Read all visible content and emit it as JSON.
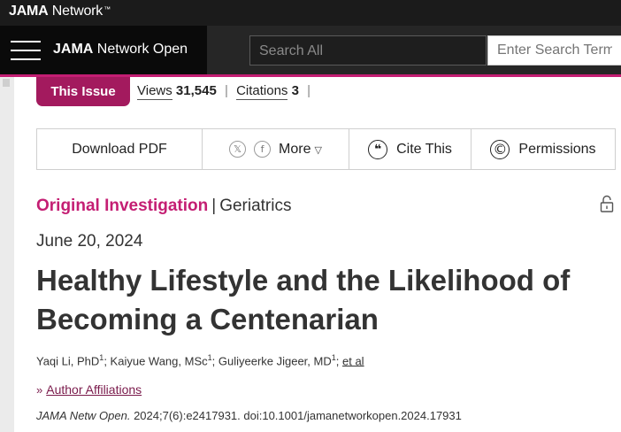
{
  "network_bar": {
    "logo_bold": "JAMA",
    "logo_rest": " Network",
    "tm": "™"
  },
  "journal_header": {
    "menu_icon": "hamburger-icon",
    "journal_bold": "JAMA",
    "journal_rest": " Network Open",
    "search_scope": "Search All",
    "search_placeholder": "Enter Search Term"
  },
  "issue_bar": {
    "this_issue_label": "This Issue",
    "views_label": "Views",
    "views_count": "31,545",
    "citations_label": "Citations",
    "citations_count": "3",
    "separator": "|"
  },
  "toolbar": {
    "download_label": "Download PDF",
    "share_icons": [
      "x-icon",
      "facebook-icon"
    ],
    "x_glyph": "𝕏",
    "fb_glyph": "f",
    "more_label": "More",
    "more_caret": "▽",
    "cite_icon_glyph": "❝",
    "cite_label": "Cite This",
    "permissions_icon_glyph": "©",
    "permissions_label": "Permissions"
  },
  "article": {
    "type": "Original Investigation",
    "type_sep": "|",
    "subject": "Geriatrics",
    "lock_icon": "unlock-icon",
    "date": "June 20, 2024",
    "title": "Healthy Lifestyle and the Likelihood of Becoming a Centenarian",
    "authors": [
      {
        "name": "Yaqi Li, PhD",
        "sup": "1"
      },
      {
        "name": "Kaiyue Wang, MSc",
        "sup": "1"
      },
      {
        "name": "Guliyeerke Jigeer, MD",
        "sup": "1"
      }
    ],
    "author_sep": "; ",
    "et_al": "et al",
    "affiliations_chevron": "»",
    "affiliations_label": "Author Affiliations",
    "citation_journal": "JAMA Netw Open.",
    "citation_rest": " 2024;7(6):e2417931. doi:10.1001/jamanetworkopen.2024.17931"
  },
  "colors": {
    "accent": "#c41e73",
    "issue_badge": "#a31a5e",
    "header_dark": "#0a0a0a"
  }
}
